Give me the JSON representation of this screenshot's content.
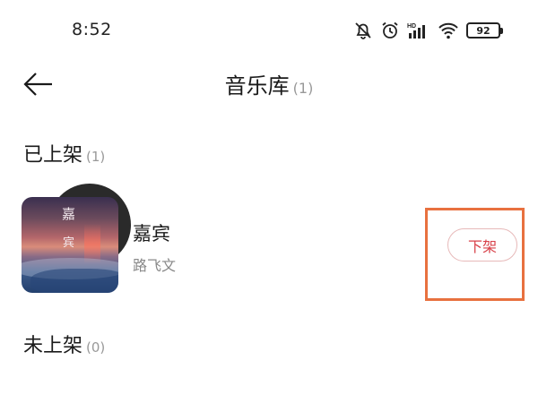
{
  "status_bar": {
    "time": "8:52",
    "battery": "92",
    "icons": [
      "mute-bell-icon",
      "alarm-icon",
      "hd-signal-icon",
      "wifi-icon",
      "battery-icon"
    ],
    "hd_label": "HD"
  },
  "header": {
    "back_icon": "arrow-left-icon",
    "title": "音乐库",
    "count": "(1)"
  },
  "sections": {
    "listed": {
      "label": "已上架",
      "count": "(1)"
    },
    "unlisted": {
      "label": "未上架",
      "count": "(0)"
    }
  },
  "song": {
    "title": "嘉宾",
    "artist": "路飞文",
    "cover_text_1": "嘉",
    "cover_text_2": "宾",
    "remove_label": "下架"
  },
  "colors": {
    "accent": "#d8424a",
    "highlight": "#e8713f",
    "muted_text": "#888888"
  }
}
